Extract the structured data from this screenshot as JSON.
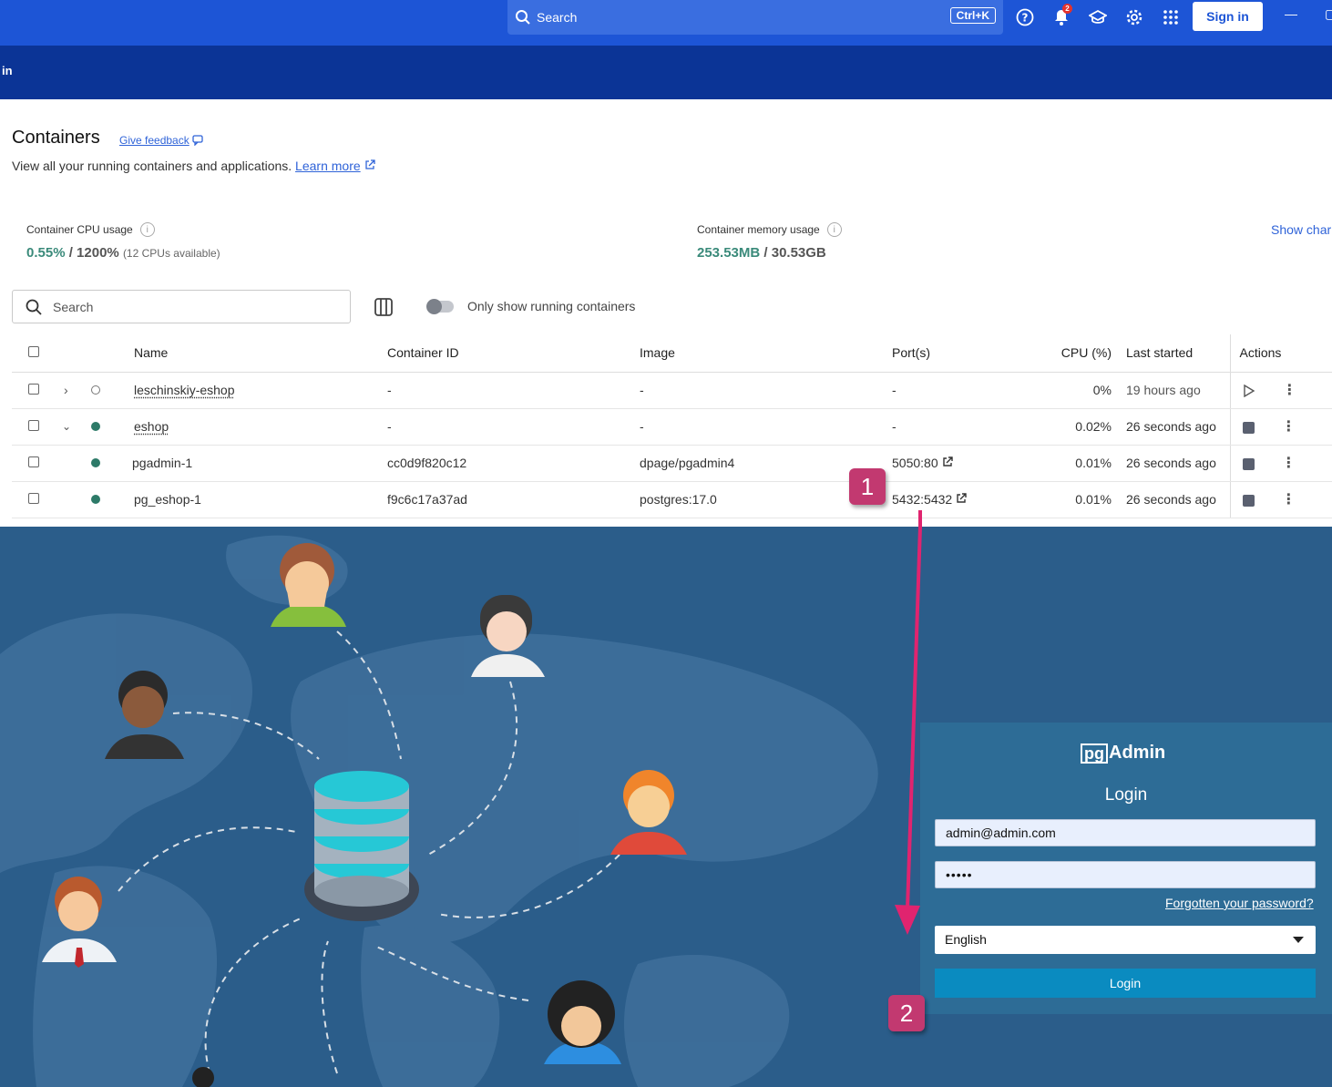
{
  "topbar": {
    "search_placeholder": "Search",
    "shortcut": "Ctrl+K",
    "notification_count": "2",
    "signin_label": "Sign in"
  },
  "banner": {
    "text": "in"
  },
  "page": {
    "title": "Containers",
    "feedback_link": "Give feedback",
    "subtitle": "View all your running containers and applications.",
    "learn_more": "Learn more"
  },
  "stats": {
    "cpu_label": "Container CPU usage",
    "cpu_value": "0.55%",
    "cpu_total": " / 1200%",
    "cpu_note": "(12 CPUs available)",
    "mem_label": "Container memory usage",
    "mem_value": "253.53MB",
    "mem_total": " / 30.53GB",
    "show_charts": "Show char"
  },
  "filters": {
    "search_placeholder": "Search",
    "toggle_label": "Only show running containers",
    "toggle_on": false
  },
  "table": {
    "headers": {
      "name": "Name",
      "id": "Container ID",
      "image": "Image",
      "ports": "Port(s)",
      "cpu": "CPU (%)",
      "started": "Last started",
      "actions": "Actions"
    },
    "rows": [
      {
        "name": "leschinskiy-eshop",
        "id": "-",
        "image": "-",
        "ports": "-",
        "cpu": "0%",
        "started": "19 hours ago",
        "running": false
      },
      {
        "name": "eshop",
        "id": "-",
        "image": "-",
        "ports": "-",
        "cpu": "0.02%",
        "started": "26 seconds ago",
        "running": true
      },
      {
        "name": "pgadmin-1",
        "id": "cc0d9f820c12",
        "image": "dpage/pgadmin4",
        "ports": "5050:80",
        "cpu": "0.01%",
        "started": "26 seconds ago",
        "running": true
      },
      {
        "name": "pg_eshop-1",
        "id": "f9c6c17a37ad",
        "image": "postgres:17.0",
        "ports": "5432:5432",
        "cpu": "0.01%",
        "started": "26 seconds ago",
        "running": true
      }
    ]
  },
  "pgadmin": {
    "logo_pg": "pg",
    "logo_rest": "Admin",
    "title": "Login",
    "email": "admin@admin.com",
    "password": "•••••",
    "forgot": "Forgotten your password?",
    "language": "English",
    "login_button": "Login"
  },
  "callouts": {
    "one": "1",
    "two": "2"
  },
  "colors": {
    "accent": "#1d55d6",
    "banner": "#0b3496",
    "running": "#2d7a68",
    "callout": "#c23970",
    "login": "#0a8bc0"
  }
}
